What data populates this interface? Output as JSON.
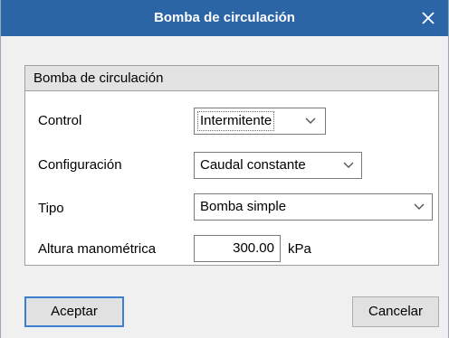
{
  "dialog": {
    "title": "Bomba de circulación",
    "group_title": "Bomba de circulación"
  },
  "fields": {
    "control": {
      "label": "Control",
      "value": "Intermitente"
    },
    "configuracion": {
      "label": "Configuración",
      "value": "Caudal constante"
    },
    "tipo": {
      "label": "Tipo",
      "value": "Bomba simple"
    },
    "altura": {
      "label": "Altura manométrica",
      "value": "300.00",
      "unit": "kPa"
    }
  },
  "buttons": {
    "accept": "Aceptar",
    "cancel": "Cancelar"
  },
  "icons": {
    "close": "close-icon",
    "dropdown": "chevron-down-icon"
  },
  "colors": {
    "titlebar": "#2b65a6",
    "default_button_border": "#3c7fd0"
  }
}
